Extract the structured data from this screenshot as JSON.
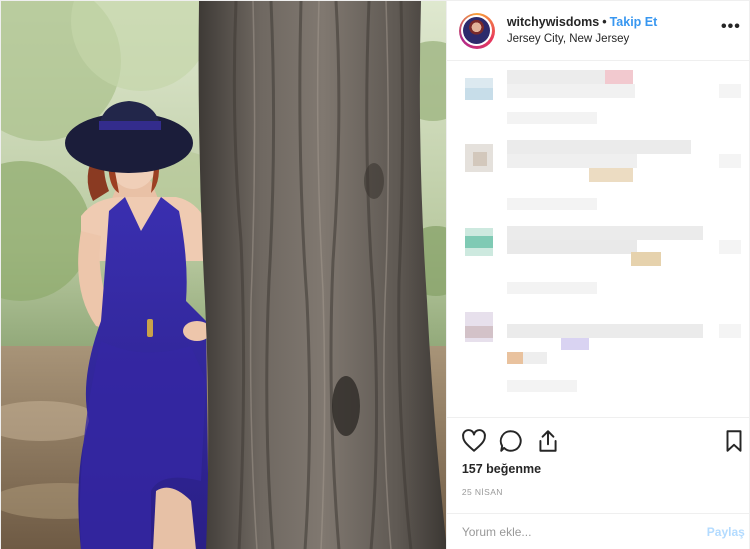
{
  "header": {
    "username": "witchywisdoms",
    "separator": "•",
    "follow_label": "Takip Et",
    "location": "Jersey City, New Jersey",
    "more_label": "•••"
  },
  "photo": {
    "subject": "woman-in-blue-dress-and-hat-behind-tree"
  },
  "actions": {
    "icons": [
      "heart-icon",
      "comment-icon",
      "share-icon",
      "bookmark-icon"
    ],
    "likes_text": "157 beğenme",
    "date_text": "25 NİSAN"
  },
  "add_comment": {
    "placeholder": "Yorum ekle...",
    "submit_label": "Paylaş"
  },
  "colors": {
    "accent": "#3897f0",
    "submit_disabled": "#b3dbff",
    "dress": "#3b2fa6",
    "hat": "#1c1f3d"
  }
}
